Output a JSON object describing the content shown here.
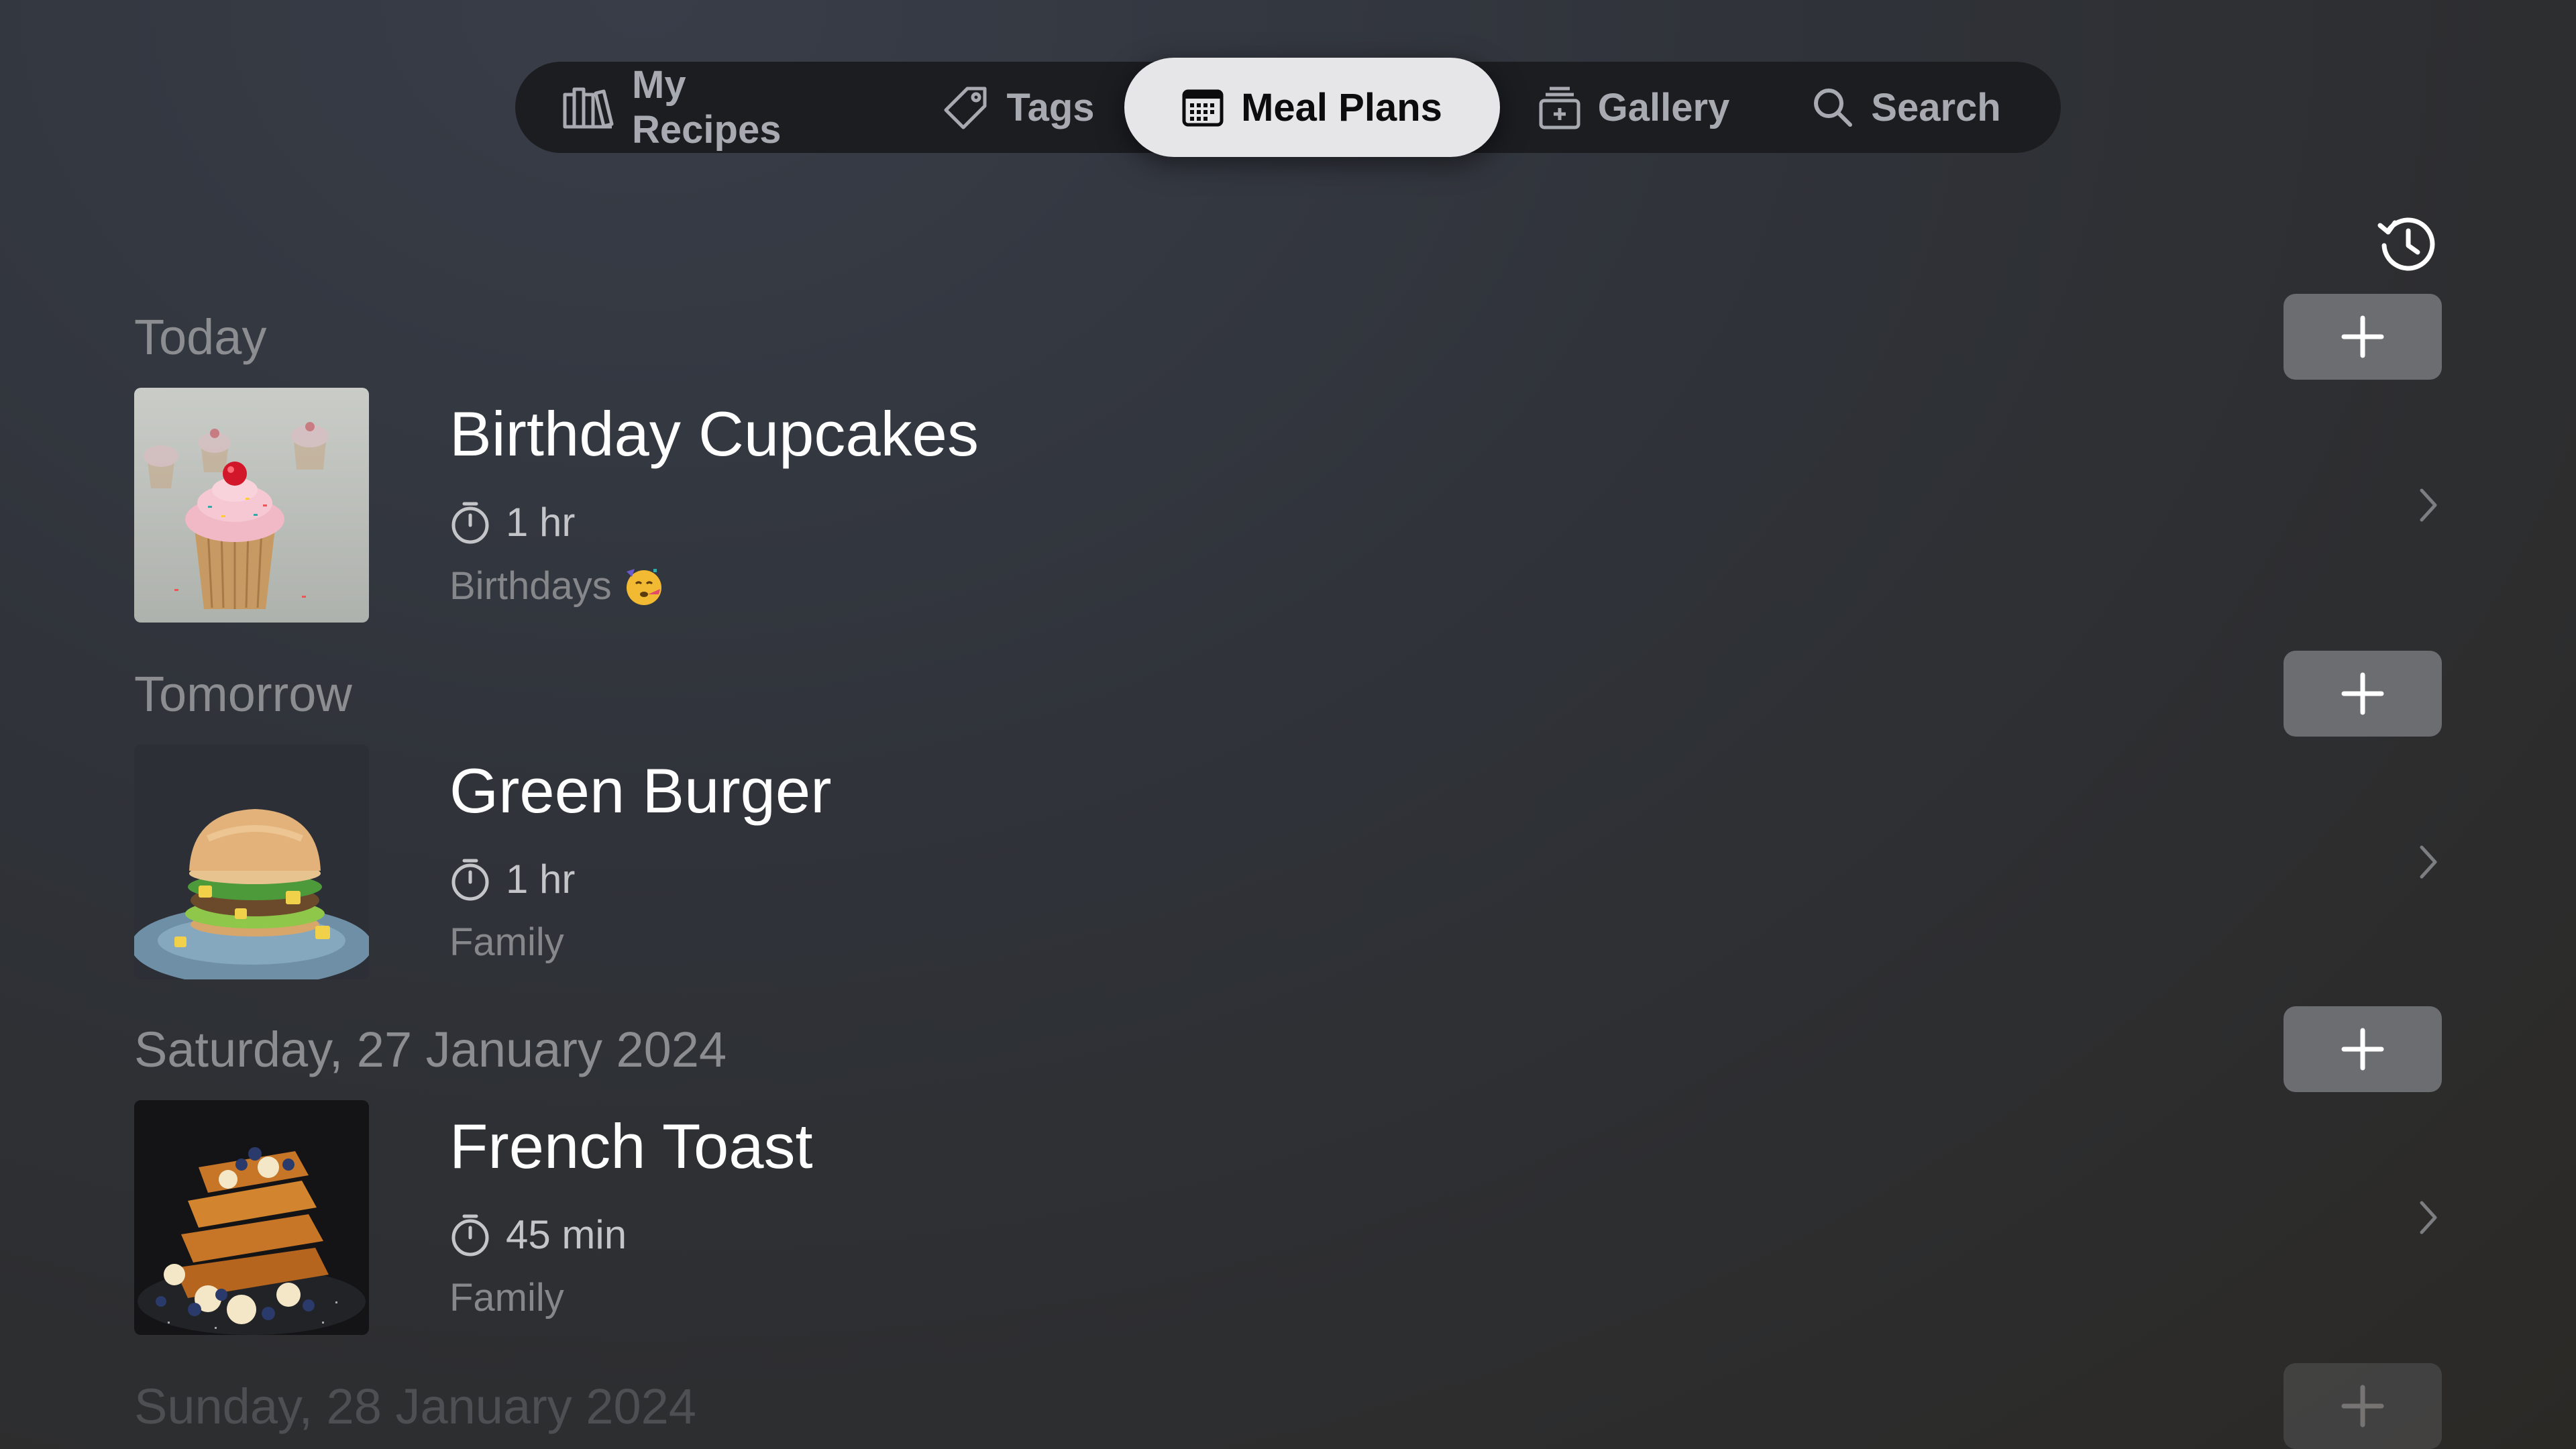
{
  "tabs": [
    {
      "label": "My Recipes",
      "icon": "books-icon",
      "active": false
    },
    {
      "label": "Tags",
      "icon": "tag-icon",
      "active": false
    },
    {
      "label": "Meal Plans",
      "icon": "calendar-icon",
      "active": true
    },
    {
      "label": "Gallery",
      "icon": "gallery-stack-icon",
      "active": false
    },
    {
      "label": "Search",
      "icon": "search-icon",
      "active": false
    }
  ],
  "toolbar": {
    "history_icon": "history-icon"
  },
  "days": [
    {
      "label": "Today",
      "recipe": {
        "title": "Birthday Cupcakes",
        "duration": "1 hr",
        "tag": "Birthdays",
        "tag_emoji": "party-face-icon",
        "image": "cupcake-photo"
      }
    },
    {
      "label": "Tomorrow",
      "recipe": {
        "title": "Green Burger",
        "duration": "1 hr",
        "tag": "Family",
        "image": "burger-photo"
      }
    },
    {
      "label": "Saturday, 27 January 2024",
      "recipe": {
        "title": "French Toast",
        "duration": "45 min",
        "tag": "Family",
        "image": "french-toast-photo"
      }
    },
    {
      "label": "Sunday, 28 January 2024"
    }
  ],
  "colors": {
    "background": "#2f3238",
    "tab_bar": "#1c1d21",
    "active_tab": "#e6e6e8",
    "add_button": "#6c6d70",
    "section_header": "#8c8d91"
  }
}
